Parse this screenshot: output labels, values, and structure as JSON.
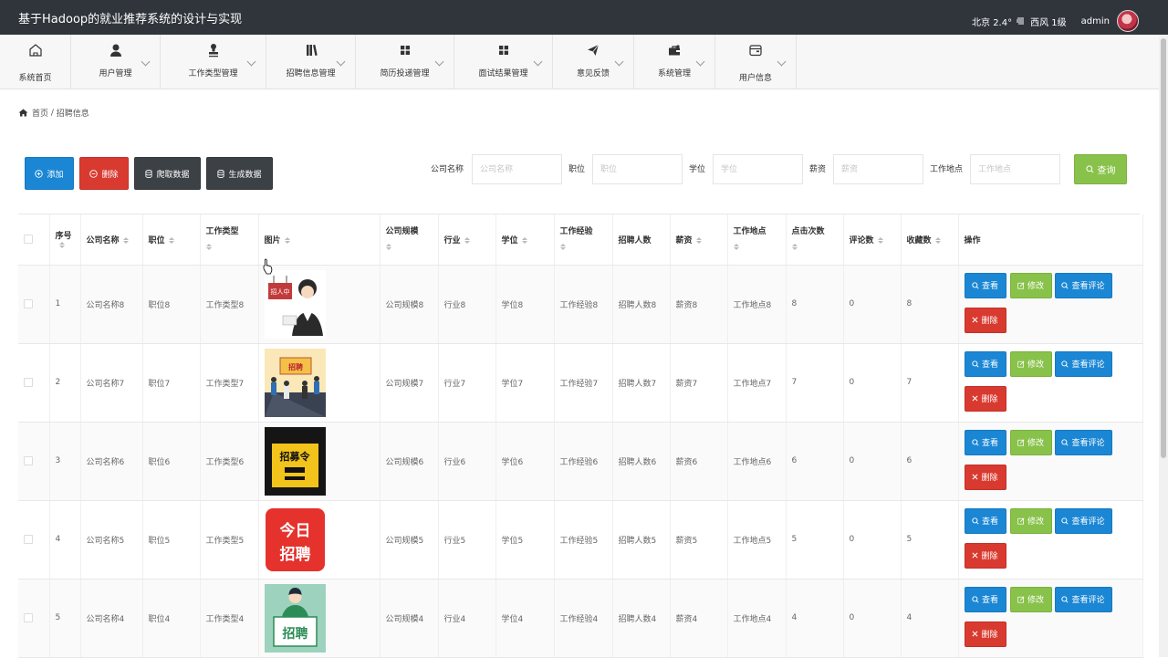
{
  "app": {
    "title": "基于Hadoop的就业推荐系统的设计与实现",
    "weather_text": "北京  2.4°",
    "wind_text": "西风  1级",
    "user": "admin"
  },
  "nav": [
    {
      "label": "系统首页",
      "icon": "home-icon",
      "chev": false
    },
    {
      "label": "用户管理",
      "icon": "user-icon",
      "chev": true
    },
    {
      "label": "工作类型管理",
      "icon": "stamp-icon",
      "chev": true
    },
    {
      "label": "招聘信息管理",
      "icon": "book-icon",
      "chev": true
    },
    {
      "label": "简历投递管理",
      "icon": "grid-icon",
      "chev": true
    },
    {
      "label": "面试结果管理",
      "icon": "grid-icon",
      "chev": true
    },
    {
      "label": "意见反馈",
      "icon": "send-icon",
      "chev": true
    },
    {
      "label": "系统管理",
      "icon": "briefcase-icon",
      "chev": true
    },
    {
      "label": "用户信息",
      "icon": "wallet-icon",
      "chev": true
    }
  ],
  "breadcrumb": {
    "home": "首页",
    "separator": " / ",
    "current": "招聘信息"
  },
  "toolbar": {
    "add": "添加",
    "delete": "删除",
    "crawl": "爬取数据",
    "generate": "生成数据",
    "search": "查询"
  },
  "filters": [
    {
      "label": "公司名称",
      "placeholder": "公司名称"
    },
    {
      "label": "职位",
      "placeholder": "职位"
    },
    {
      "label": "学位",
      "placeholder": "学位"
    },
    {
      "label": "薪资",
      "placeholder": "薪资"
    },
    {
      "label": "工作地点",
      "placeholder": "工作地点"
    }
  ],
  "table": {
    "headers": [
      "序号",
      "公司名称",
      "职位",
      "工作类型",
      "图片",
      "公司规模",
      "行业",
      "学位",
      "工作经验",
      "招聘人数",
      "薪资",
      "工作地点",
      "点击次数",
      "评论数",
      "收藏数",
      "操作"
    ],
    "rows": [
      {
        "no": "1",
        "company": "公司名称8",
        "job": "职位8",
        "type": "工作类型8",
        "scale": "公司规模8",
        "industry": "行业8",
        "degree": "学位8",
        "exp": "工作经验8",
        "count": "招聘人数8",
        "salary": "薪资8",
        "place": "工作地点8",
        "clicks": "8",
        "comments": "0",
        "favs": "8",
        "img": "person"
      },
      {
        "no": "2",
        "company": "公司名称7",
        "job": "职位7",
        "type": "工作类型7",
        "scale": "公司规模7",
        "industry": "行业7",
        "degree": "学位7",
        "exp": "工作经验7",
        "count": "招聘人数7",
        "salary": "薪资7",
        "place": "工作地点7",
        "clicks": "7",
        "comments": "0",
        "favs": "7",
        "img": "crowd"
      },
      {
        "no": "3",
        "company": "公司名称6",
        "job": "职位6",
        "type": "工作类型6",
        "scale": "公司规模6",
        "industry": "行业6",
        "degree": "学位6",
        "exp": "工作经验6",
        "count": "招聘人数6",
        "salary": "薪资6",
        "place": "工作地点6",
        "clicks": "6",
        "comments": "0",
        "favs": "6",
        "img": "poster"
      },
      {
        "no": "4",
        "company": "公司名称5",
        "job": "职位5",
        "type": "工作类型5",
        "scale": "公司规模5",
        "industry": "行业5",
        "degree": "学位5",
        "exp": "工作经验5",
        "count": "招聘人数5",
        "salary": "薪资5",
        "place": "工作地点5",
        "clicks": "5",
        "comments": "0",
        "favs": "5",
        "img": "today"
      },
      {
        "no": "5",
        "company": "公司名称4",
        "job": "职位4",
        "type": "工作类型4",
        "scale": "公司规模4",
        "industry": "行业4",
        "degree": "学位4",
        "exp": "工作经验4",
        "count": "招聘人数4",
        "salary": "薪资4",
        "place": "工作地点4",
        "clicks": "4",
        "comments": "0",
        "favs": "4",
        "img": "sign"
      }
    ],
    "ops": {
      "view": "查看",
      "edit": "修改",
      "comments": "查看评论",
      "delete": "删除"
    }
  },
  "image_text": {
    "person": "招人中",
    "crowd": "招聘",
    "poster": "招募令",
    "today_1": "今日",
    "today_2": "招聘",
    "sign": "招聘"
  },
  "colors": {
    "primary": "#1b87d4",
    "success": "#88c24a",
    "danger": "#d93a2f",
    "dark": "#3c4146",
    "topbar": "#2f353b"
  }
}
